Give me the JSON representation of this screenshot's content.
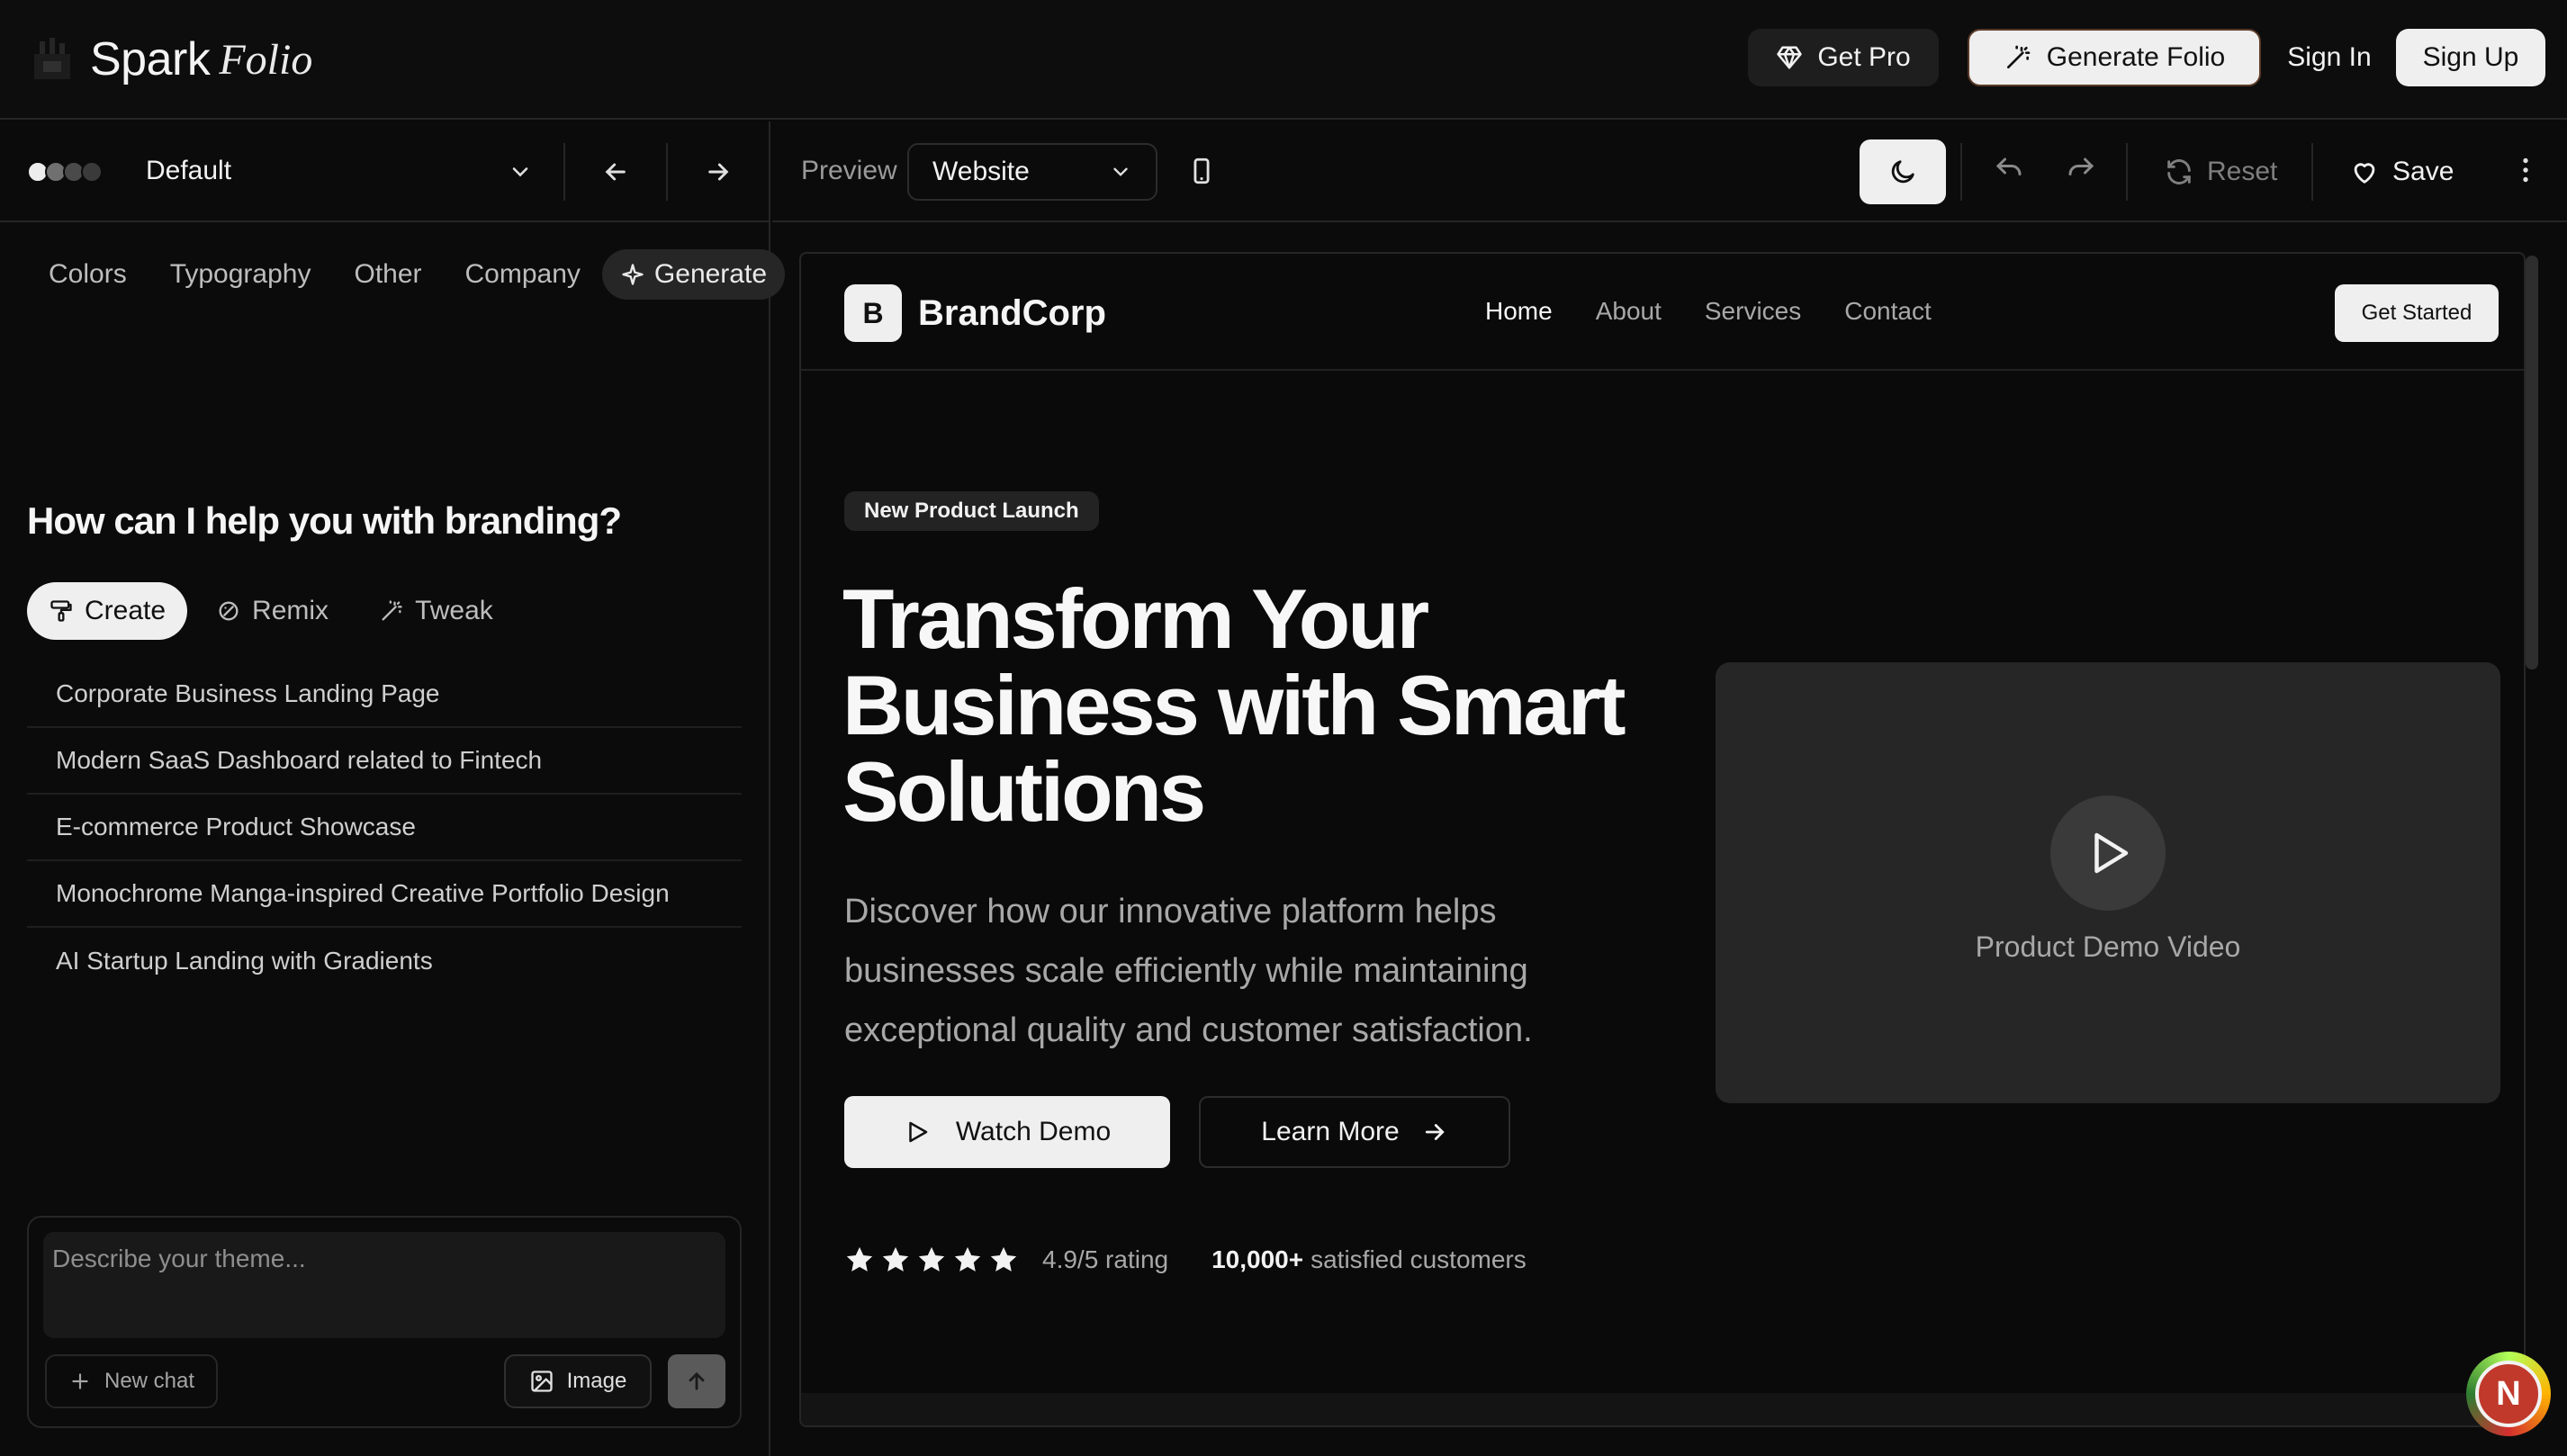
{
  "app": {
    "name": "Spark",
    "name_script": "Folio"
  },
  "header": {
    "get_pro": "Get Pro",
    "generate_folio": "Generate Folio",
    "sign_in": "Sign In",
    "sign_up": "Sign Up"
  },
  "theme": {
    "name": "Default",
    "swatches": [
      "#ededed",
      "#707070",
      "#4a4a4a",
      "#3a3a3a"
    ]
  },
  "left_tabs": [
    "Colors",
    "Typography",
    "Other",
    "Company",
    "Generate"
  ],
  "assistant": {
    "question": "How can I help you with branding?",
    "modes": [
      "Create",
      "Remix",
      "Tweak"
    ],
    "suggestions": [
      "Corporate Business Landing Page",
      "Modern SaaS Dashboard related to Fintech",
      "E-commerce Product Showcase",
      "Monochrome Manga-inspired Creative Portfolio Design",
      "AI Startup Landing with Gradients"
    ],
    "placeholder": "Describe your theme...",
    "new_chat": "New chat",
    "image": "Image"
  },
  "preview_bar": {
    "label": "Preview",
    "mode": "Website",
    "reset": "Reset",
    "save": "Save"
  },
  "site": {
    "brand_letter": "B",
    "brand_name": "BrandCorp",
    "nav": [
      "Home",
      "About",
      "Services",
      "Contact"
    ],
    "cta": "Get Started",
    "badge": "New Product Launch",
    "title": "Transform Your Business with Smart Solutions",
    "subtitle": "Discover how our innovative platform helps businesses scale efficiently while maintaining exceptional quality and customer satisfaction.",
    "watch_demo": "Watch Demo",
    "learn_more": "Learn More",
    "stars": 5,
    "rating": "4.9/5 rating",
    "customers_count": "10,000+",
    "customers_label": "satisfied customers",
    "video_label": "Product Demo Video"
  },
  "user": {
    "initial": "N"
  }
}
